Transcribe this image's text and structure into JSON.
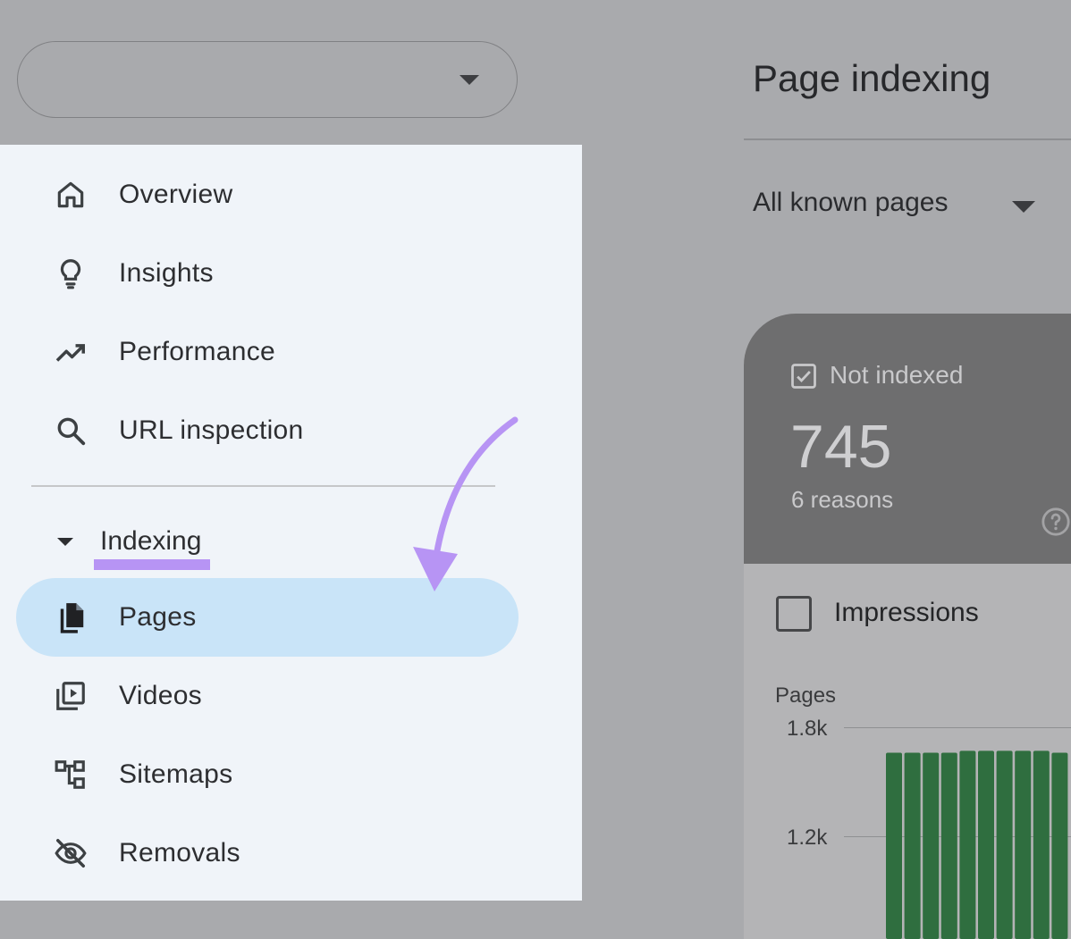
{
  "header": {
    "property_selector": {
      "value": ""
    },
    "page_title": "Page indexing",
    "filter": {
      "selected": "All known pages"
    }
  },
  "sidebar": {
    "items": [
      {
        "label": "Overview",
        "icon": "home-icon"
      },
      {
        "label": "Insights",
        "icon": "lightbulb-icon"
      },
      {
        "label": "Performance",
        "icon": "trending-up-icon"
      },
      {
        "label": "URL inspection",
        "icon": "search-icon"
      }
    ],
    "section": {
      "label": "Indexing",
      "expanded": true
    },
    "indexing_items": [
      {
        "label": "Pages",
        "icon": "pages-icon",
        "active": true
      },
      {
        "label": "Videos",
        "icon": "video-library-icon"
      },
      {
        "label": "Sitemaps",
        "icon": "sitemap-icon"
      },
      {
        "label": "Removals",
        "icon": "visibility-off-icon"
      }
    ]
  },
  "annotation": {
    "color": "#b794f4"
  },
  "card": {
    "not_indexed": {
      "label": "Not indexed",
      "count": "745",
      "reasons": "6 reasons",
      "checked": true
    },
    "impressions": {
      "label": "Impressions",
      "checked": false
    }
  },
  "chart_data": {
    "type": "bar",
    "ylabel": "Pages",
    "y_ticks": [
      "1.8k",
      "1.2k"
    ],
    "ylim": [
      0,
      2000
    ],
    "color": "#2f6e3f",
    "series": [
      {
        "values": [
          1660,
          1660,
          1660,
          1660,
          1670,
          1670,
          1670,
          1670,
          1670,
          1660
        ]
      }
    ]
  },
  "colors": {
    "sidebar_bg": "#f0f4f9",
    "active_bg": "#c9e4f8",
    "overlay": "#a9aaad"
  }
}
